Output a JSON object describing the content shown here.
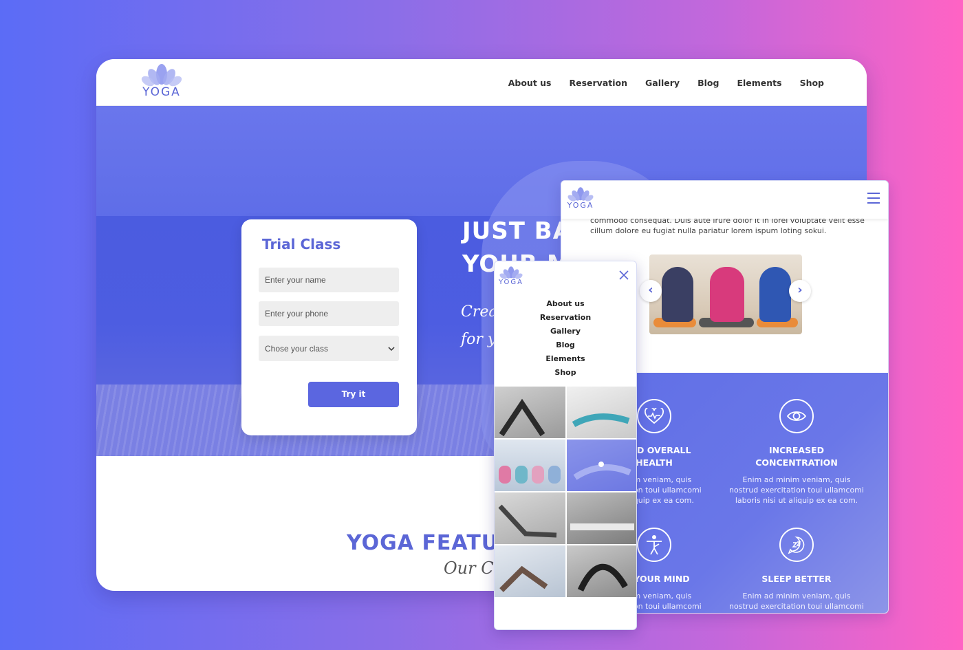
{
  "brand": {
    "logo_text": "YOGA"
  },
  "desktop": {
    "nav": [
      {
        "label": "About us"
      },
      {
        "label": "Reservation"
      },
      {
        "label": "Gallery"
      },
      {
        "label": "Blog"
      },
      {
        "label": "Elements"
      },
      {
        "label": "Shop"
      }
    ],
    "hero": {
      "title_line1": "JUST BA",
      "title_line2": "YOUR M",
      "script_line1": "Creat",
      "script_line2": "for yo"
    },
    "trial": {
      "title": "Trial Class",
      "name_placeholder": "Enter your name",
      "phone_placeholder": "Enter your phone",
      "class_select": "Chose your class",
      "submit": "Try it"
    },
    "features": {
      "title": "YOGA FEATUR",
      "subtitle": "Our Cla"
    }
  },
  "tablet": {
    "text_line1": "commodo consequat. Duis aute irure dolor it in lorel voluptate velit esse",
    "text_line2": "cillum dolore eu fugiat nulla pariatur lorem ispum loting sokui.",
    "carousel": {
      "prev": "‹",
      "next": "›"
    },
    "benefits": [
      {
        "icon": "heart-pulse-icon",
        "title_l1": "OVED OVERALL",
        "title_l2": "HEALTH",
        "text_l1": "minim veniam, quis",
        "text_l2": "ercitation toui ullamcomi",
        "text_l3": "ut aliquip ex ea com."
      },
      {
        "icon": "eye-icon",
        "title_l1": "INCREASED",
        "title_l2": "CONCENTRATION",
        "text_l1": "Enim ad minim veniam, quis",
        "text_l2": "nostrud exercitation toui ullamcomi",
        "text_l3": "laboris nisi ut aliquip ex ea com."
      },
      {
        "icon": "yoga-pose-icon",
        "title_l1": "CE YOUR MIND",
        "text_l1": "minim veniam, quis",
        "text_l2": "ercitation toui ullamcomi"
      },
      {
        "icon": "sleep-icon",
        "title_l1": "SLEEP BETTER",
        "text_l1": "Enim ad minim veniam, quis",
        "text_l2": "nostrud exercitation toui ullamcomi"
      }
    ]
  },
  "phone": {
    "menu": [
      {
        "label": "About us"
      },
      {
        "label": "Reservation"
      },
      {
        "label": "Gallery"
      },
      {
        "label": "Blog"
      },
      {
        "label": "Elements"
      },
      {
        "label": "Shop"
      }
    ]
  },
  "colors": {
    "accent": "#5b66d6",
    "button": "#5b66e0",
    "bg_left": "#5b6cf6",
    "bg_right": "#ff63c4"
  }
}
